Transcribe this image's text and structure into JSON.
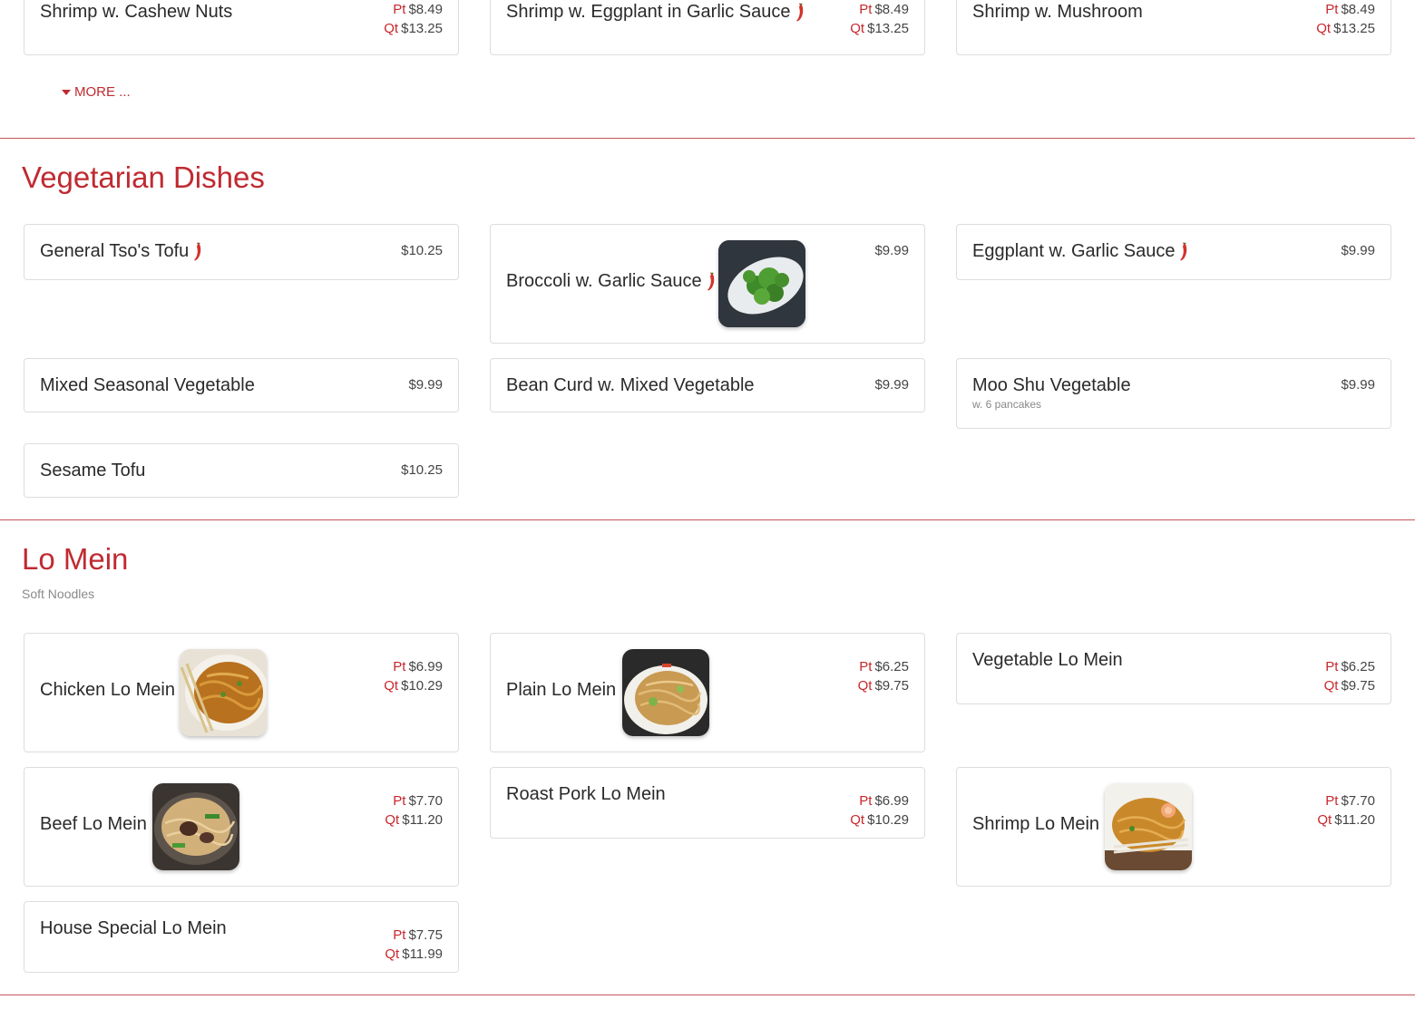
{
  "colors": {
    "accent": "#c02a31",
    "divider": "#c8555a",
    "card_border": "#dddddd"
  },
  "top_items": [
    {
      "name": "Shrimp w. Cashew Nuts",
      "spicy": false,
      "pt_label": "Pt",
      "pt": "$8.49",
      "qt_label": "Qt",
      "qt": "$13.25"
    },
    {
      "name": "Shrimp w. Eggplant in Garlic Sauce",
      "spicy": true,
      "pt_label": "Pt",
      "pt": "$8.49",
      "qt_label": "Qt",
      "qt": "$13.25"
    },
    {
      "name": "Shrimp w. Mushroom",
      "spicy": false,
      "pt_label": "Pt",
      "pt": "$8.49",
      "qt_label": "Qt",
      "qt": "$13.25"
    }
  ],
  "more_link": {
    "label": "MORE ...",
    "icon": "caret-down-icon"
  },
  "vegetarian": {
    "title": "Vegetarian Dishes",
    "items": [
      {
        "name": "General Tso's Tofu",
        "spicy": true,
        "price": "$10.25"
      },
      {
        "name": "Broccoli w. Garlic Sauce",
        "spicy": true,
        "price": "$9.99",
        "image": "broccoli-photo"
      },
      {
        "name": "Eggplant w. Garlic Sauce",
        "spicy": true,
        "price": "$9.99"
      },
      {
        "name": "Mixed Seasonal Vegetable",
        "spicy": false,
        "price": "$9.99"
      },
      {
        "name": "Bean Curd w. Mixed Vegetable",
        "spicy": false,
        "price": "$9.99"
      },
      {
        "name": "Moo Shu Vegetable",
        "spicy": false,
        "price": "$9.99",
        "note": "w. 6 pancakes"
      },
      {
        "name": "Sesame Tofu",
        "spicy": false,
        "price": "$10.25"
      }
    ]
  },
  "lo_mein": {
    "title": "Lo Mein",
    "subtitle": "Soft Noodles",
    "items": [
      {
        "name": "Chicken Lo Mein",
        "pt_label": "Pt",
        "pt": "$6.99",
        "qt_label": "Qt",
        "qt": "$10.29",
        "image": "chicken-lo-mein-photo"
      },
      {
        "name": "Plain Lo Mein",
        "pt_label": "Pt",
        "pt": "$6.25",
        "qt_label": "Qt",
        "qt": "$9.75",
        "image": "plain-lo-mein-photo"
      },
      {
        "name": "Vegetable Lo Mein",
        "pt_label": "Pt",
        "pt": "$6.25",
        "qt_label": "Qt",
        "qt": "$9.75"
      },
      {
        "name": "Beef Lo Mein",
        "pt_label": "Pt",
        "pt": "$7.70",
        "qt_label": "Qt",
        "qt": "$11.20",
        "image": "beef-lo-mein-photo"
      },
      {
        "name": "Roast Pork Lo Mein",
        "pt_label": "Pt",
        "pt": "$6.99",
        "qt_label": "Qt",
        "qt": "$10.29"
      },
      {
        "name": "Shrimp Lo Mein",
        "pt_label": "Pt",
        "pt": "$7.70",
        "qt_label": "Qt",
        "qt": "$11.20",
        "image": "shrimp-lo-mein-photo"
      },
      {
        "name": "House Special Lo Mein",
        "pt_label": "Pt",
        "pt": "$7.75",
        "qt_label": "Qt",
        "qt": "$11.99"
      }
    ]
  }
}
